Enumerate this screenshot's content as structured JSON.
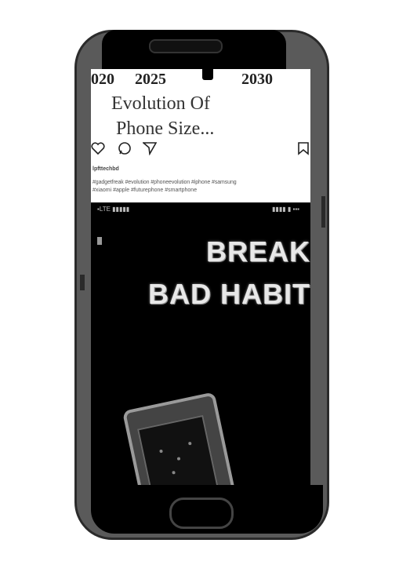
{
  "post": {
    "years": [
      "020",
      "2025",
      "2030"
    ],
    "title_line1": "Evolution Of",
    "title_line2": "Phone Size...",
    "user_line": "lpfttechbd",
    "tags_line1": "#gadgetfreak #evolution #phoneevolution #iphone #samsung",
    "tags_line2": "#xiaomi #apple #futurephone #smartphone"
  },
  "video": {
    "status_left": "▪LTE ▮▮▮▮▮",
    "status_right": "▮▮▮▮ ▮ ▪▪▪",
    "headline_line1": "BREAK",
    "headline_line2": "BAD HABIT"
  },
  "icons": [
    "heart-icon",
    "comment-icon",
    "share-icon",
    "bookmark-icon"
  ],
  "colors": {
    "phone_body": "#5a5a5a",
    "screen_dark": "#000000",
    "headline_text": "#e8e8e8"
  }
}
